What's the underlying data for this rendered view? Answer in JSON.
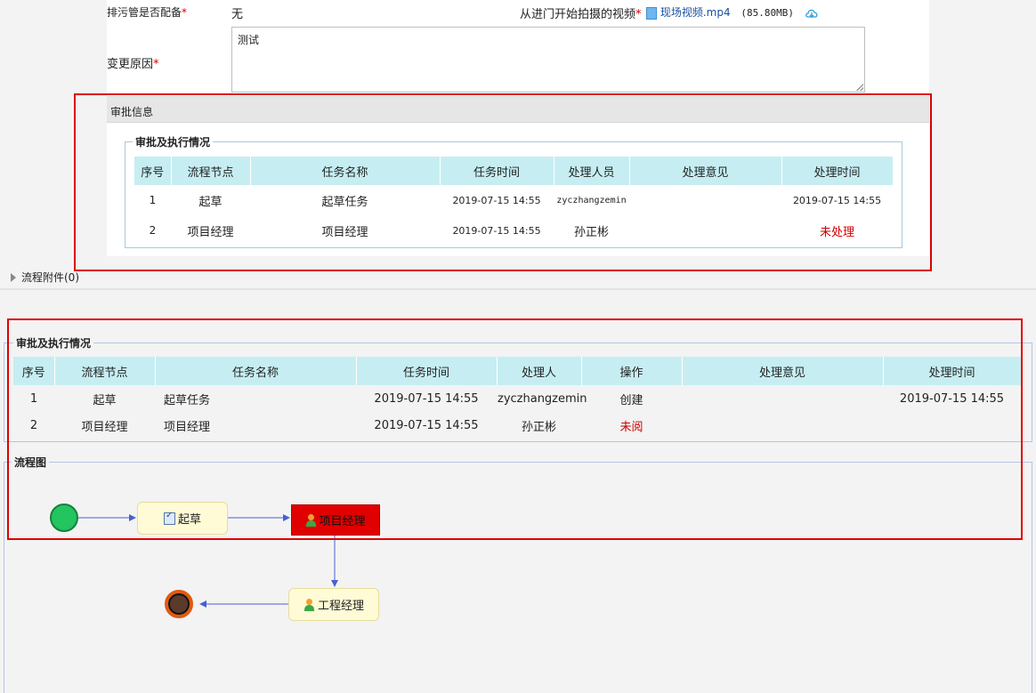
{
  "form": {
    "discharge_label": "排污管是否配备",
    "discharge_value": "无",
    "video_label": "从进门开始拍摄的视频",
    "video_file": "现场视频.mp4",
    "video_size": "(85.80MB)",
    "change_reason_label": "变更原因",
    "change_reason_value": "测试",
    "required_mark": "*"
  },
  "approval_info": {
    "header": "审批信息",
    "group_title": "审批及执行情况",
    "columns": [
      "序号",
      "流程节点",
      "任务名称",
      "任务时间",
      "处理人员",
      "处理意见",
      "处理时间"
    ],
    "rows": [
      {
        "no": "1",
        "node": "起草",
        "task": "起草任务",
        "time": "2019-07-15 14:55",
        "handler": "zyczhangzemin",
        "opinion": "",
        "handled_time": "2019-07-15 14:55"
      },
      {
        "no": "2",
        "node": "项目经理",
        "task": "项目经理",
        "time": "2019-07-15 14:55",
        "handler": "孙正彬",
        "opinion": "",
        "handled_time": "未处理"
      }
    ]
  },
  "attachments": {
    "label": "流程附件(0)"
  },
  "execution": {
    "group_title": "审批及执行情况",
    "columns": [
      "序号",
      "流程节点",
      "任务名称",
      "任务时间",
      "处理人",
      "操作",
      "处理意见",
      "处理时间"
    ],
    "rows": [
      {
        "no": "1",
        "node": "起草",
        "task": "起草任务",
        "time": "2019-07-15 14:55",
        "handler": "zyczhangzemin",
        "action": "创建",
        "opinion": "",
        "handled_time": "2019-07-15 14:55"
      },
      {
        "no": "2",
        "node": "项目经理",
        "task": "项目经理",
        "time": "2019-07-15 14:55",
        "handler": "孙正彬",
        "action": "未阅",
        "opinion": "",
        "handled_time": ""
      }
    ]
  },
  "flowchart": {
    "title": "流程图",
    "nodes": {
      "draft": "起草",
      "project_manager": "项目经理",
      "engineering_manager": "工程经理"
    }
  },
  "colors": {
    "header_bg": "#c6eef2",
    "highlight_red": "#e00000",
    "active_node": "#e00000",
    "start_node": "#22c55e"
  }
}
